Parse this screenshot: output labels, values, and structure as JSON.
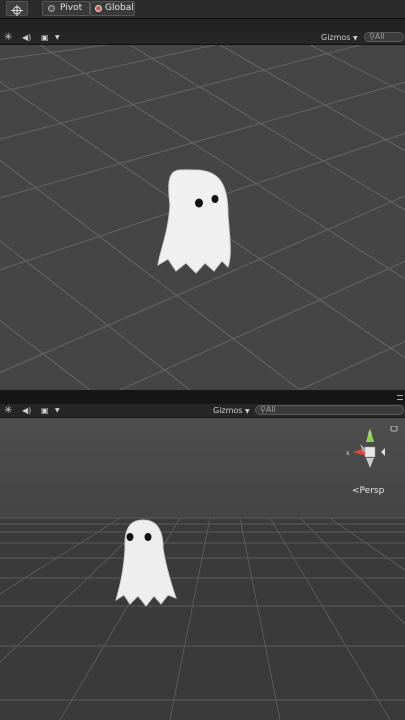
{
  "toolbar": {
    "pivot_label": "Pivot",
    "global_label": "Global"
  },
  "scene_top": {
    "gizmos_label": "Gizmos",
    "search_placeholder": "All"
  },
  "scene_bottom": {
    "gizmos_label": "Gizmos",
    "search_placeholder": "All",
    "projection_label": "Persp"
  },
  "colors": {
    "gizmo_y": "#8fd14f",
    "gizmo_x": "#e0473a",
    "ghost": "#f2f2f2"
  }
}
